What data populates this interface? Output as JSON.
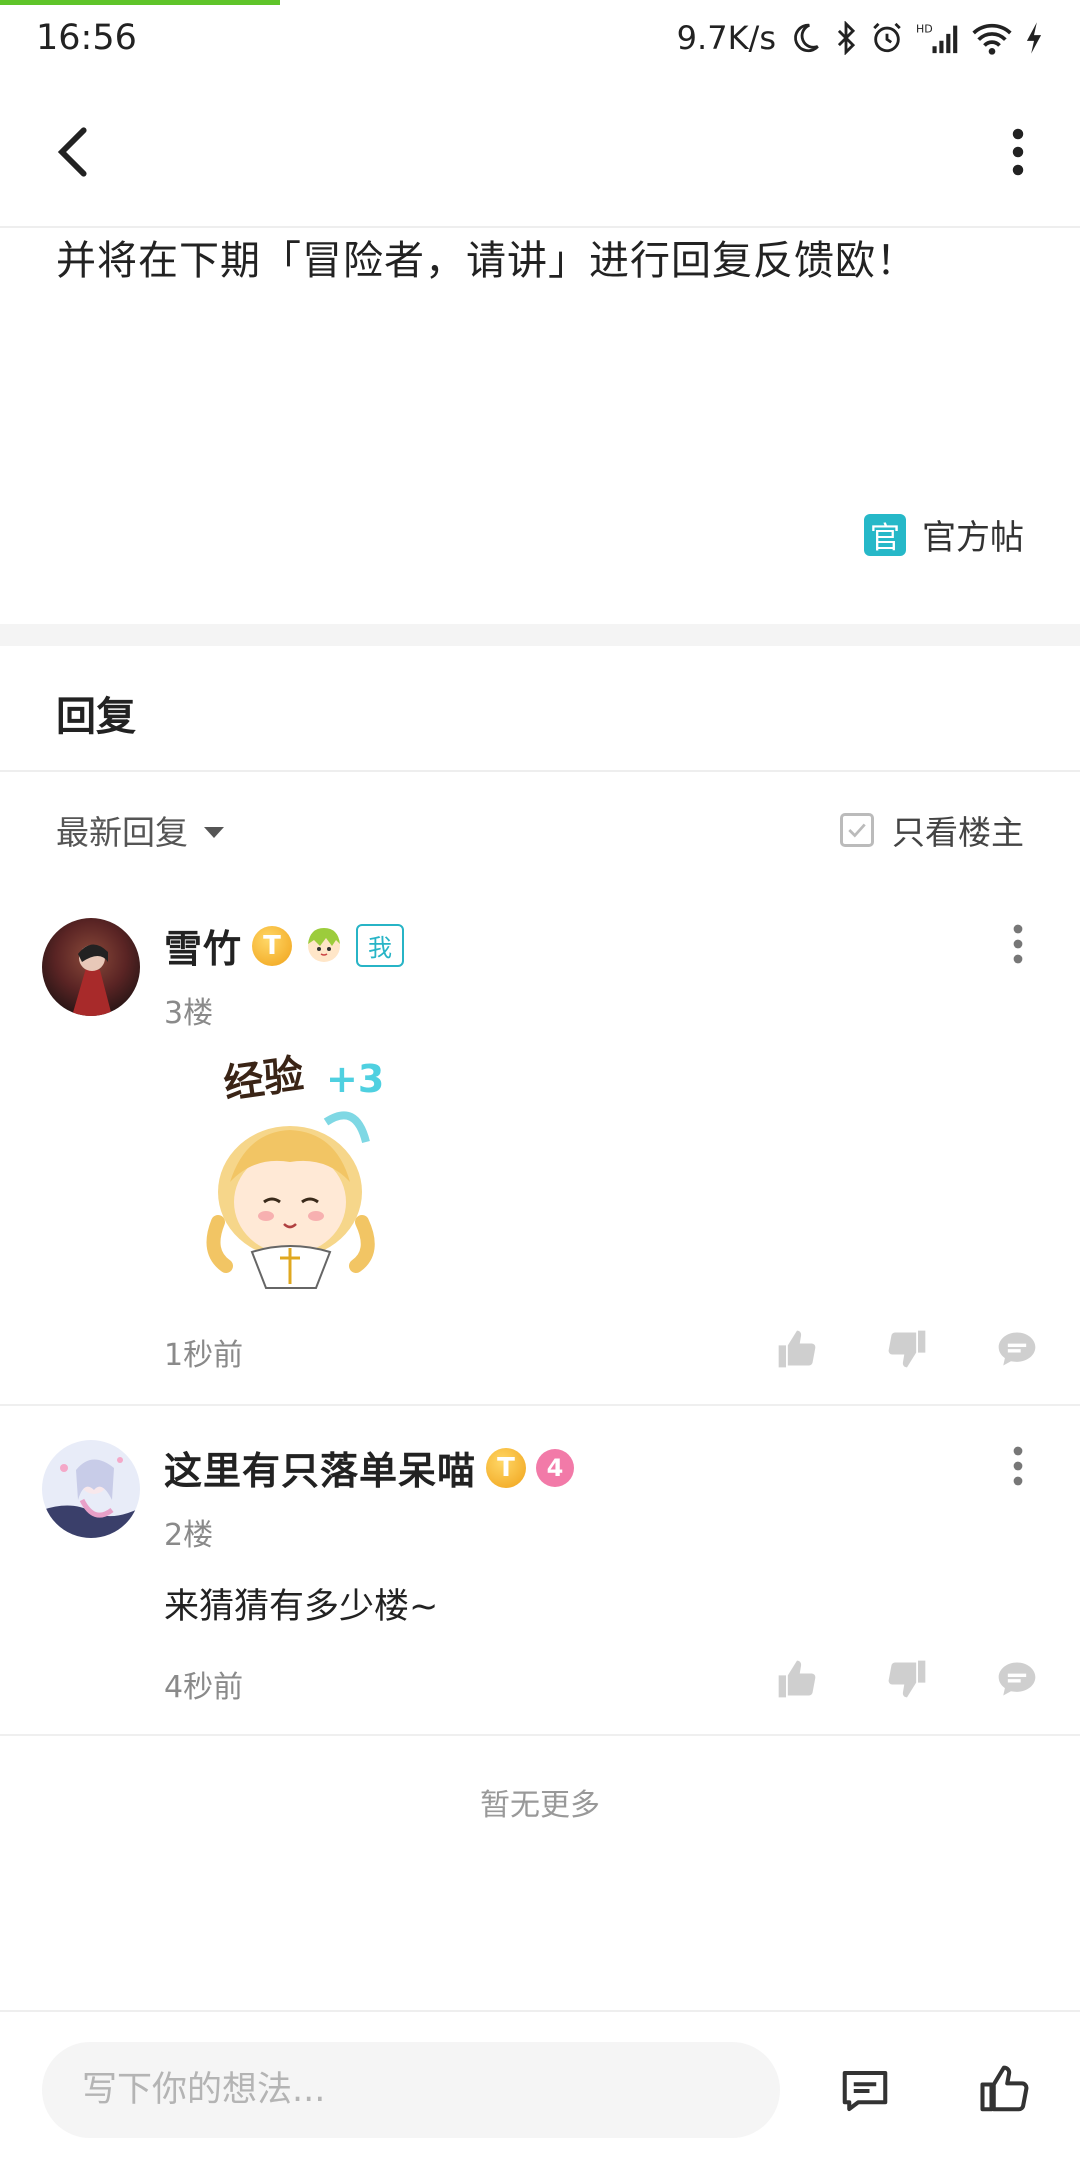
{
  "status_bar": {
    "time": "16:56",
    "net_speed": "9.7K/s",
    "hd_label": "HD"
  },
  "post": {
    "text_tail": "并将在下期「冒险者，请讲」进行回复反馈欧！",
    "official_badge": "官",
    "official_label": "官方帖"
  },
  "replies_section": {
    "title": "回复",
    "sort_label": "最新回复",
    "only_owner_label": "只看楼主"
  },
  "comments": [
    {
      "username": "雪竹",
      "coin_letter": "T",
      "me_badge": "我",
      "floor": "3楼",
      "sticker_text": "经验",
      "sticker_plus": "+3",
      "time": "1秒前"
    },
    {
      "username": "这里有只落单呆喵",
      "coin_letter": "T",
      "level": "4",
      "floor": "2楼",
      "text": "来猜猜有多少楼~",
      "time": "4秒前"
    }
  ],
  "no_more": "暂无更多",
  "bottom_bar": {
    "input_placeholder": "写下你的想法..."
  },
  "colors": {
    "accent": "#26b8c8",
    "progress": "#5fc42a",
    "coin": "#f0a21a",
    "level_pink": "#f27aa8"
  }
}
